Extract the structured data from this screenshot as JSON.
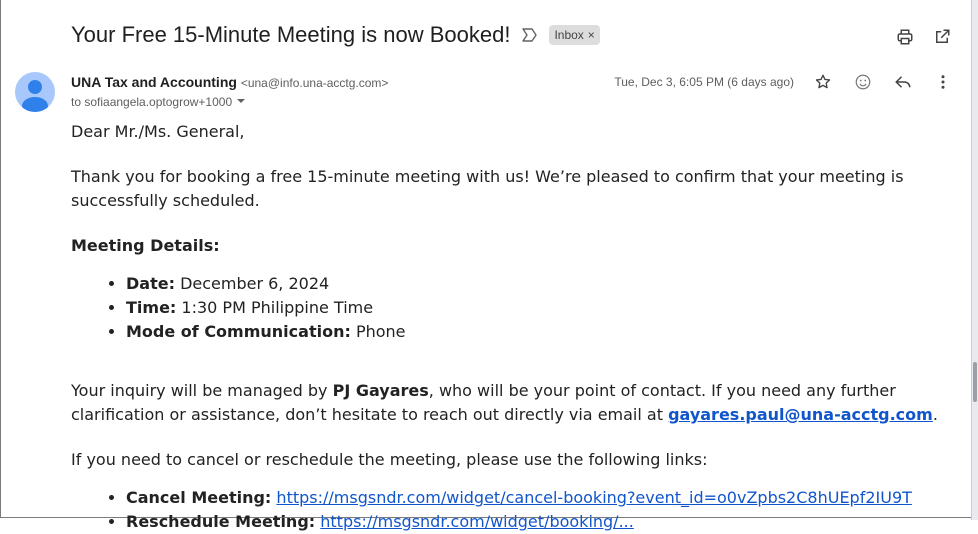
{
  "email": {
    "subject": "Your Free 15-Minute Meeting is now Booked!",
    "label": "Inbox",
    "label_close": "×",
    "sender_name": "UNA Tax and Accounting",
    "sender_email": "<una@info.una-acctg.com>",
    "to_line": "to sofiaangela.optogrow+1000",
    "date": "Tue, Dec 3, 6:05 PM (6 days ago)",
    "greeting": "Dear Mr./Ms. General,",
    "intro": "Thank you for booking a free 15-minute meeting with us! We’re pleased to confirm that your meeting is successfully scheduled.",
    "details_heading": "Meeting Details:",
    "details": [
      {
        "label": "Date:",
        "value": " December 6, 2024"
      },
      {
        "label": "Time:",
        "value": " 1:30 PM Philippine Time"
      },
      {
        "label": "Mode of Communication:",
        "value": " Phone"
      }
    ],
    "contact_pre": "Your inquiry will be managed by ",
    "contact_name": "PJ Gayares",
    "contact_post": ", who will be your point of contact. If you need any further clarification or assistance, don’t hesitate to reach out directly via email at ",
    "contact_email": "gayares.paul@una-acctg.com",
    "contact_end": ".",
    "cancel_intro": "If you need to cancel or reschedule the meeting, please use the following links:",
    "links": [
      {
        "label": "Cancel Meeting:",
        "url": "https://msgsndr.com/widget/cancel-booking?event_id=o0vZpbs2C8hUEpf2IU9T"
      },
      {
        "label": "Reschedule Meeting:",
        "url": "https://msgsndr.com/widget/booking/..."
      }
    ]
  },
  "icons": {
    "importance": "importance-marker-icon",
    "print": "print-icon",
    "open_new": "open-in-new-window-icon",
    "star": "star-icon",
    "emoji": "emoji-reaction-icon",
    "reply": "reply-icon",
    "more": "more-vert-icon",
    "dropdown": "chevron-down-icon"
  },
  "colors": {
    "link": "#1155cc",
    "avatar": "#a8c7fa",
    "label_chip": "#dddddd"
  }
}
